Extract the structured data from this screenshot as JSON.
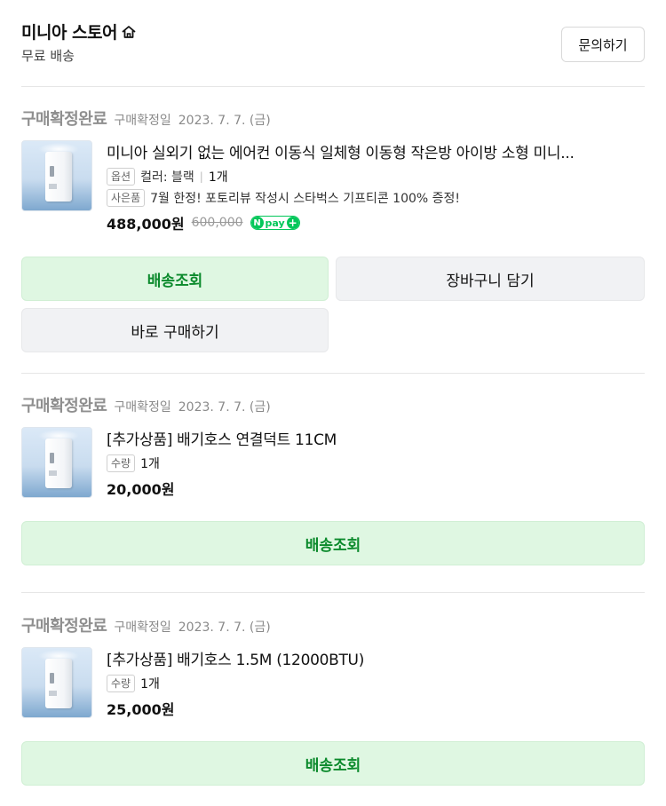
{
  "store": {
    "name": "미니아 스토어",
    "subtitle": "무료 배송",
    "inquiry_label": "문의하기"
  },
  "orders": [
    {
      "status": "구매확정완료",
      "date_label": "구매확정일",
      "date": "2023. 7. 7. (금)",
      "title": "미니아 실외기 없는 에어컨 이동식 일체형 이동형 작은방 아이방 소형 미니...",
      "option_tag": "옵션",
      "option_text": "컬러: 블랙",
      "option_sep": "|",
      "quantity": "1개",
      "gift_tag": "사은품",
      "gift_text": "7월 한정! 포토리뷰 작성시 스타벅스 기프티콘 100% 증정!",
      "price": "488,000원",
      "original_price": "600,000",
      "npay": {
        "n": "N",
        "text": "pay",
        "plus": "+"
      },
      "buttons": {
        "track": "배송조회",
        "cart": "장바구니 담기",
        "buy_now": "바로 구매하기"
      }
    },
    {
      "status": "구매확정완료",
      "date_label": "구매확정일",
      "date": "2023. 7. 7. (금)",
      "title": "[추가상품] 배기호스 연결덕트 11CM",
      "qty_tag": "수량",
      "quantity": "1개",
      "price": "20,000원",
      "buttons": {
        "track": "배송조회"
      }
    },
    {
      "status": "구매확정완료",
      "date_label": "구매확정일",
      "date": "2023. 7. 7. (금)",
      "title": "[추가상품] 배기호스 1.5M (12000BTU)",
      "qty_tag": "수량",
      "quantity": "1개",
      "price": "25,000원",
      "buttons": {
        "track": "배송조회"
      }
    }
  ],
  "colors": {
    "accent_green": "#0b8a2c",
    "green_button_bg": "#dff7e2",
    "gray_button_bg": "#f1f2f4",
    "status_gray": "#8f8f8f",
    "npay_green": "#03c75a"
  }
}
